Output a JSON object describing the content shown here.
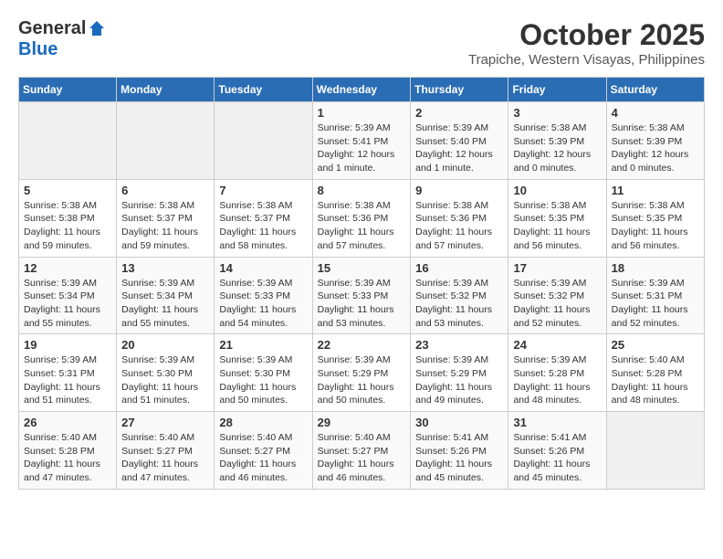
{
  "header": {
    "logo_general": "General",
    "logo_blue": "Blue",
    "title": "October 2025",
    "subtitle": "Trapiche, Western Visayas, Philippines"
  },
  "calendar": {
    "days_of_week": [
      "Sunday",
      "Monday",
      "Tuesday",
      "Wednesday",
      "Thursday",
      "Friday",
      "Saturday"
    ],
    "weeks": [
      [
        {
          "day": "",
          "info": ""
        },
        {
          "day": "",
          "info": ""
        },
        {
          "day": "",
          "info": ""
        },
        {
          "day": "1",
          "info": "Sunrise: 5:39 AM\nSunset: 5:41 PM\nDaylight: 12 hours\nand 1 minute."
        },
        {
          "day": "2",
          "info": "Sunrise: 5:39 AM\nSunset: 5:40 PM\nDaylight: 12 hours\nand 1 minute."
        },
        {
          "day": "3",
          "info": "Sunrise: 5:38 AM\nSunset: 5:39 PM\nDaylight: 12 hours\nand 0 minutes."
        },
        {
          "day": "4",
          "info": "Sunrise: 5:38 AM\nSunset: 5:39 PM\nDaylight: 12 hours\nand 0 minutes."
        }
      ],
      [
        {
          "day": "5",
          "info": "Sunrise: 5:38 AM\nSunset: 5:38 PM\nDaylight: 11 hours\nand 59 minutes."
        },
        {
          "day": "6",
          "info": "Sunrise: 5:38 AM\nSunset: 5:37 PM\nDaylight: 11 hours\nand 59 minutes."
        },
        {
          "day": "7",
          "info": "Sunrise: 5:38 AM\nSunset: 5:37 PM\nDaylight: 11 hours\nand 58 minutes."
        },
        {
          "day": "8",
          "info": "Sunrise: 5:38 AM\nSunset: 5:36 PM\nDaylight: 11 hours\nand 57 minutes."
        },
        {
          "day": "9",
          "info": "Sunrise: 5:38 AM\nSunset: 5:36 PM\nDaylight: 11 hours\nand 57 minutes."
        },
        {
          "day": "10",
          "info": "Sunrise: 5:38 AM\nSunset: 5:35 PM\nDaylight: 11 hours\nand 56 minutes."
        },
        {
          "day": "11",
          "info": "Sunrise: 5:38 AM\nSunset: 5:35 PM\nDaylight: 11 hours\nand 56 minutes."
        }
      ],
      [
        {
          "day": "12",
          "info": "Sunrise: 5:39 AM\nSunset: 5:34 PM\nDaylight: 11 hours\nand 55 minutes."
        },
        {
          "day": "13",
          "info": "Sunrise: 5:39 AM\nSunset: 5:34 PM\nDaylight: 11 hours\nand 55 minutes."
        },
        {
          "day": "14",
          "info": "Sunrise: 5:39 AM\nSunset: 5:33 PM\nDaylight: 11 hours\nand 54 minutes."
        },
        {
          "day": "15",
          "info": "Sunrise: 5:39 AM\nSunset: 5:33 PM\nDaylight: 11 hours\nand 53 minutes."
        },
        {
          "day": "16",
          "info": "Sunrise: 5:39 AM\nSunset: 5:32 PM\nDaylight: 11 hours\nand 53 minutes."
        },
        {
          "day": "17",
          "info": "Sunrise: 5:39 AM\nSunset: 5:32 PM\nDaylight: 11 hours\nand 52 minutes."
        },
        {
          "day": "18",
          "info": "Sunrise: 5:39 AM\nSunset: 5:31 PM\nDaylight: 11 hours\nand 52 minutes."
        }
      ],
      [
        {
          "day": "19",
          "info": "Sunrise: 5:39 AM\nSunset: 5:31 PM\nDaylight: 11 hours\nand 51 minutes."
        },
        {
          "day": "20",
          "info": "Sunrise: 5:39 AM\nSunset: 5:30 PM\nDaylight: 11 hours\nand 51 minutes."
        },
        {
          "day": "21",
          "info": "Sunrise: 5:39 AM\nSunset: 5:30 PM\nDaylight: 11 hours\nand 50 minutes."
        },
        {
          "day": "22",
          "info": "Sunrise: 5:39 AM\nSunset: 5:29 PM\nDaylight: 11 hours\nand 50 minutes."
        },
        {
          "day": "23",
          "info": "Sunrise: 5:39 AM\nSunset: 5:29 PM\nDaylight: 11 hours\nand 49 minutes."
        },
        {
          "day": "24",
          "info": "Sunrise: 5:39 AM\nSunset: 5:28 PM\nDaylight: 11 hours\nand 48 minutes."
        },
        {
          "day": "25",
          "info": "Sunrise: 5:40 AM\nSunset: 5:28 PM\nDaylight: 11 hours\nand 48 minutes."
        }
      ],
      [
        {
          "day": "26",
          "info": "Sunrise: 5:40 AM\nSunset: 5:28 PM\nDaylight: 11 hours\nand 47 minutes."
        },
        {
          "day": "27",
          "info": "Sunrise: 5:40 AM\nSunset: 5:27 PM\nDaylight: 11 hours\nand 47 minutes."
        },
        {
          "day": "28",
          "info": "Sunrise: 5:40 AM\nSunset: 5:27 PM\nDaylight: 11 hours\nand 46 minutes."
        },
        {
          "day": "29",
          "info": "Sunrise: 5:40 AM\nSunset: 5:27 PM\nDaylight: 11 hours\nand 46 minutes."
        },
        {
          "day": "30",
          "info": "Sunrise: 5:41 AM\nSunset: 5:26 PM\nDaylight: 11 hours\nand 45 minutes."
        },
        {
          "day": "31",
          "info": "Sunrise: 5:41 AM\nSunset: 5:26 PM\nDaylight: 11 hours\nand 45 minutes."
        },
        {
          "day": "",
          "info": ""
        }
      ]
    ]
  }
}
